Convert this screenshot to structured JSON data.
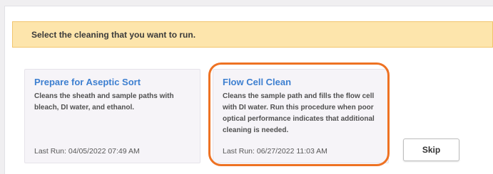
{
  "banner": {
    "text": "Select the cleaning that you want to run."
  },
  "cards": [
    {
      "title": "Prepare for Aseptic Sort",
      "description": "Cleans the sheath and sample paths with bleach, DI water, and ethanol.",
      "last_run": "Last Run: 04/05/2022 07:49 AM"
    },
    {
      "title": "Flow Cell Clean",
      "description": "Cleans the sample path and fills the flow cell with DI water. Run this procedure when poor optical performance indicates that additional cleaning is needed.",
      "last_run": "Last Run: 06/27/2022 11:03 AM",
      "highlighted": true
    }
  ],
  "buttons": {
    "skip_label": "Skip"
  },
  "colors": {
    "banner_bg": "#fde5ac",
    "card_title": "#3d7fd0",
    "highlight": "#ee7223"
  }
}
